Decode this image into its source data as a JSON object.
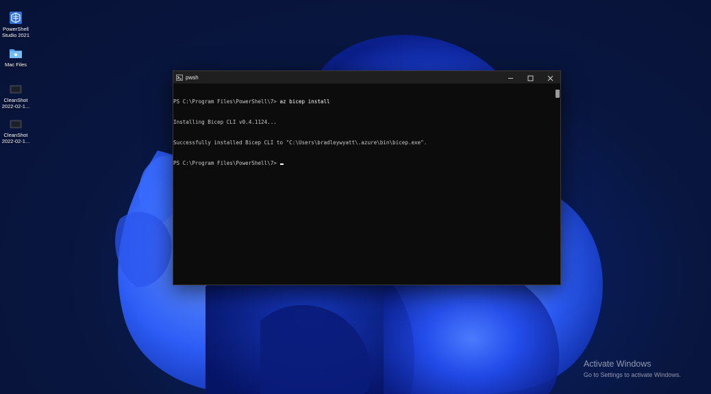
{
  "desktop": {
    "icons": [
      {
        "label_line1": "PowerShell",
        "label_line2": "Studio 2021",
        "icon": "powershell-studio-icon"
      },
      {
        "label_line1": "Mac Files",
        "label_line2": "",
        "icon": "folder-icon"
      },
      {
        "label_line1": "CleanShot",
        "label_line2": "2022-02-1...",
        "icon": "screenshot-file-icon"
      },
      {
        "label_line1": "CleanShot",
        "label_line2": "2022-02-1...",
        "icon": "screenshot-file-icon"
      }
    ]
  },
  "terminal": {
    "tab_title": "pwsh",
    "tab_icon": "powershell-icon",
    "controls": {
      "minimize": "minimize-icon",
      "maximize": "maximize-icon",
      "close": "close-icon"
    },
    "lines": [
      {
        "prompt": "PS C:\\Program Files\\PowerShell\\7> ",
        "command": "az bicep install"
      },
      {
        "text": "Installing Bicep CLI v0.4.1124..."
      },
      {
        "text": "Successfully installed Bicep CLI to \"C:\\Users\\bradleywyatt\\.azure\\bin\\bicep.exe\"."
      },
      {
        "prompt": "PS C:\\Program Files\\PowerShell\\7> ",
        "command": ""
      }
    ]
  },
  "watermark": {
    "title": "Activate Windows",
    "subtitle": "Go to Settings to activate Windows."
  },
  "colors": {
    "terminal_bg": "#0c0c0c",
    "titlebar_bg": "#1f1f1f",
    "text": "#cccccc",
    "wallpaper_accent": "#2a4cf0"
  }
}
